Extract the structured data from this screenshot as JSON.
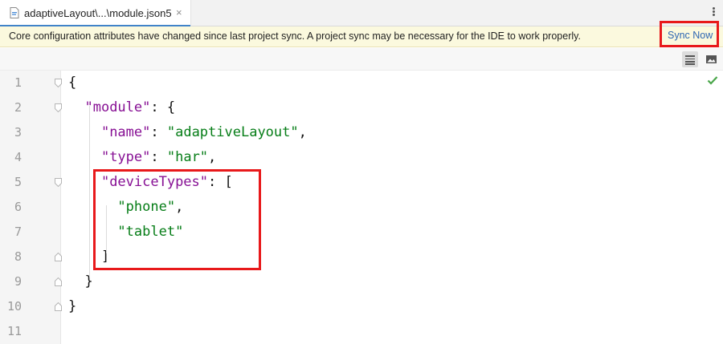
{
  "tab": {
    "title": "adaptiveLayout\\...\\module.json5",
    "close": "×"
  },
  "banner": {
    "message": "Core configuration attributes have changed since last project sync. A project sync may be necessary for the IDE to work properly.",
    "action": "Sync Now",
    "background_color": "#fbf9de",
    "action_color": "#2d66b2"
  },
  "toolbar": {
    "buttons": [
      "list-icon",
      "image-preview-icon"
    ]
  },
  "editor": {
    "line_numbers": [
      "1",
      "2",
      "3",
      "4",
      "5",
      "6",
      "7",
      "8",
      "9",
      "10",
      "11"
    ],
    "lines": [
      [
        {
          "t": "p",
          "v": "{"
        }
      ],
      [
        {
          "t": "p",
          "v": "  "
        },
        {
          "t": "k",
          "v": "\"module\""
        },
        {
          "t": "p",
          "v": ": {"
        }
      ],
      [
        {
          "t": "p",
          "v": "    "
        },
        {
          "t": "k",
          "v": "\"name\""
        },
        {
          "t": "p",
          "v": ": "
        },
        {
          "t": "s",
          "v": "\"adaptiveLayout\""
        },
        {
          "t": "p",
          "v": ","
        }
      ],
      [
        {
          "t": "p",
          "v": "    "
        },
        {
          "t": "k",
          "v": "\"type\""
        },
        {
          "t": "p",
          "v": ": "
        },
        {
          "t": "s",
          "v": "\"har\""
        },
        {
          "t": "p",
          "v": ","
        }
      ],
      [
        {
          "t": "p",
          "v": "    "
        },
        {
          "t": "k",
          "v": "\"deviceTypes\""
        },
        {
          "t": "p",
          "v": ": ["
        }
      ],
      [
        {
          "t": "p",
          "v": "      "
        },
        {
          "t": "s",
          "v": "\"phone\""
        },
        {
          "t": "p",
          "v": ","
        }
      ],
      [
        {
          "t": "p",
          "v": "      "
        },
        {
          "t": "s",
          "v": "\"tablet\""
        }
      ],
      [
        {
          "t": "p",
          "v": "    ]"
        }
      ],
      [
        {
          "t": "p",
          "v": "  }"
        }
      ],
      [
        {
          "t": "p",
          "v": "}"
        }
      ],
      []
    ],
    "key_color": "#871094",
    "string_color": "#067d17",
    "status": "check-icon",
    "highlight_color": "#e8191b"
  }
}
